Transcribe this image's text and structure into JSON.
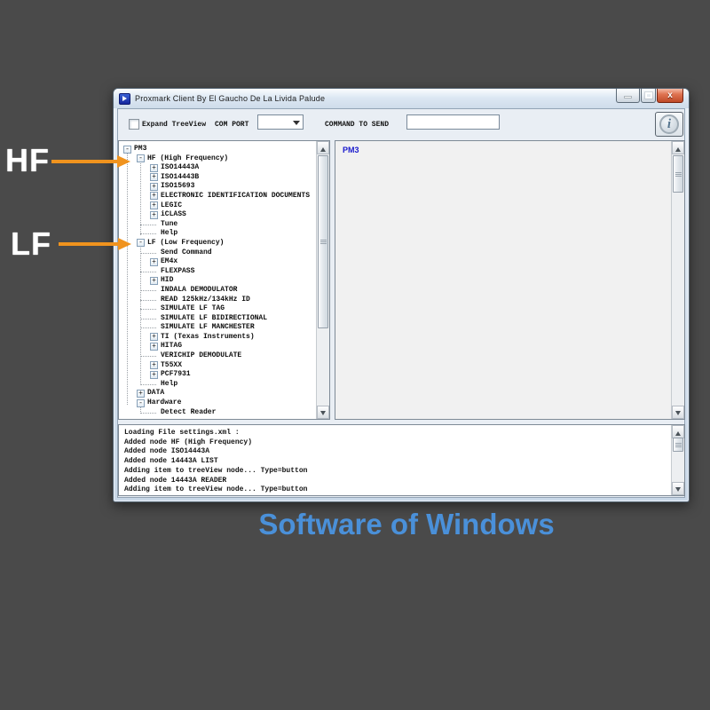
{
  "window": {
    "title": "Proxmark Client By El Gaucho De La Livida Palude",
    "icons": {
      "app": "proxmark-app-icon",
      "minimize": "minimize-icon",
      "maximize": "maximize-icon",
      "close": "close-icon"
    },
    "close_glyph": "x"
  },
  "toolbar": {
    "expand_checkbox_label": "Expand TreeView",
    "expand_checkbox_checked": false,
    "com_port_label": "COM PORT",
    "com_port_value": "",
    "command_label": "COMMAND TO SEND",
    "command_value": "",
    "info_icon": "info-icon",
    "info_glyph": "i"
  },
  "tree": {
    "nodes": [
      {
        "label": "PM3",
        "level": 0,
        "glyph": "minus"
      },
      {
        "label": "HF (High Frequency)",
        "level": 1,
        "glyph": "minus"
      },
      {
        "label": "ISO14443A",
        "level": 2,
        "glyph": "plus"
      },
      {
        "label": "ISO14443B",
        "level": 2,
        "glyph": "plus"
      },
      {
        "label": "ISO15693",
        "level": 2,
        "glyph": "plus"
      },
      {
        "label": "ELECTRONIC IDENTIFICATION DOCUMENTS",
        "level": 2,
        "glyph": "plus"
      },
      {
        "label": "LEGIC",
        "level": 2,
        "glyph": "plus"
      },
      {
        "label": "iCLASS",
        "level": 2,
        "glyph": "plus"
      },
      {
        "label": "Tune",
        "level": 2,
        "glyph": "leaf"
      },
      {
        "label": "Help",
        "level": 2,
        "glyph": "leaf"
      },
      {
        "label": "LF (Low Frequency)",
        "level": 1,
        "glyph": "minus"
      },
      {
        "label": "Send Command",
        "level": 2,
        "glyph": "leaf"
      },
      {
        "label": "EM4x",
        "level": 2,
        "glyph": "plus"
      },
      {
        "label": "FLEXPASS",
        "level": 2,
        "glyph": "leaf"
      },
      {
        "label": "HID",
        "level": 2,
        "glyph": "plus"
      },
      {
        "label": "INDALA DEMODULATOR",
        "level": 2,
        "glyph": "leaf"
      },
      {
        "label": "READ 125kHz/134kHz ID",
        "level": 2,
        "glyph": "leaf"
      },
      {
        "label": "SIMULATE LF TAG",
        "level": 2,
        "glyph": "leaf"
      },
      {
        "label": "SIMULATE LF BIDIRECTIONAL",
        "level": 2,
        "glyph": "leaf"
      },
      {
        "label": "SIMULATE LF MANCHESTER",
        "level": 2,
        "glyph": "leaf"
      },
      {
        "label": "TI (Texas Instruments)",
        "level": 2,
        "glyph": "plus"
      },
      {
        "label": "HITAG",
        "level": 2,
        "glyph": "plus"
      },
      {
        "label": "VERICHIP DEMODULATE",
        "level": 2,
        "glyph": "leaf"
      },
      {
        "label": "T55XX",
        "level": 2,
        "glyph": "plus"
      },
      {
        "label": "PCF7931",
        "level": 2,
        "glyph": "plus"
      },
      {
        "label": "Help",
        "level": 2,
        "glyph": "leaf"
      },
      {
        "label": "DATA",
        "level": 1,
        "glyph": "plus"
      },
      {
        "label": "Hardware",
        "level": 1,
        "glyph": "minus"
      },
      {
        "label": "Detect Reader",
        "level": 2,
        "glyph": "leaf"
      }
    ]
  },
  "right_panel": {
    "title": "PM3"
  },
  "log": {
    "lines": [
      "Loading File settings.xml :",
      "Added node HF (High Frequency)",
      "Added node ISO14443A",
      "Added node 14443A LIST",
      "Adding item to treeView node... Type=button",
      "Added node 14443A READER",
      "Adding item to treeView node... Type=button"
    ]
  },
  "annotations": {
    "hf_label": "HF",
    "lf_label": "LF",
    "caption": "Software of Windows",
    "arrow_color": "#f0931e",
    "caption_color": "#4a90d9"
  },
  "colors": {
    "background": "#4a4a4a",
    "pm3_text": "#1a1acd",
    "close_button": "#bf4a28",
    "titlebar": "#dde8f3"
  }
}
